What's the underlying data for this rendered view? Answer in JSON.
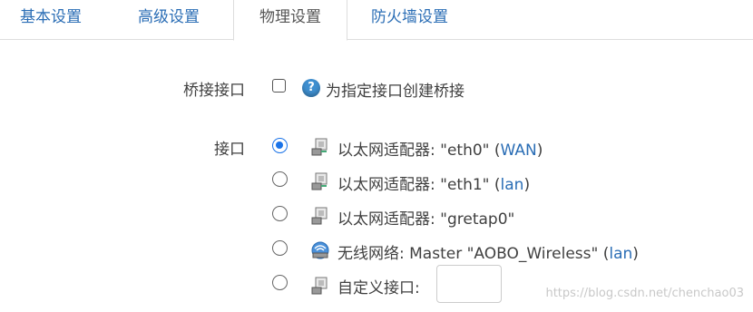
{
  "tabs": [
    {
      "label": "基本设置",
      "active": false
    },
    {
      "label": "高级设置",
      "active": false
    },
    {
      "label": "物理设置",
      "active": true
    },
    {
      "label": "防火墙设置",
      "active": false
    }
  ],
  "bridge": {
    "label": "桥接接口",
    "checked": false,
    "help_icon": "question-icon",
    "description": "为指定接口创建桥接"
  },
  "interface": {
    "label": "接口",
    "options": [
      {
        "icon": "ethernet-adapter-icon",
        "text": "以太网适配器: \"eth0\" (",
        "link": "WAN",
        "suffix": ")",
        "checked": true
      },
      {
        "icon": "ethernet-adapter-icon",
        "text": "以太网适配器: \"eth1\" (",
        "link": "lan",
        "suffix": ")",
        "checked": false
      },
      {
        "icon": "ethernet-adapter-icon",
        "text": "以太网适配器: \"gretap0\"",
        "link": "",
        "suffix": "",
        "checked": false
      },
      {
        "icon": "wireless-network-icon",
        "text": "无线网络: Master \"AOBO_Wireless\" (",
        "link": "lan",
        "suffix": ")",
        "checked": false
      },
      {
        "icon": "ethernet-adapter-icon",
        "text": "自定义接口:",
        "link": "",
        "suffix": "",
        "checked": false
      }
    ],
    "custom_value": ""
  },
  "watermark": "https://blog.csdn.net/chenchao03"
}
